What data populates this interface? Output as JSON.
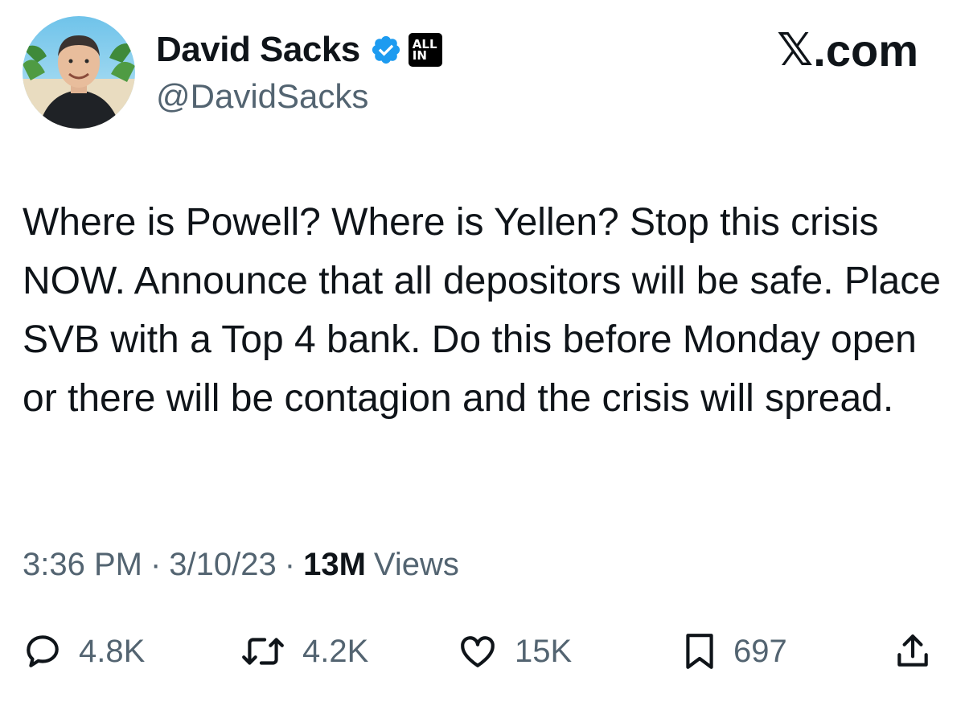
{
  "author": {
    "display_name": "David Sacks",
    "handle": "@DavidSacks",
    "verified": true,
    "affiliate_badge_line1": "ALL",
    "affiliate_badge_line2": "IN"
  },
  "brand": {
    "x_glyph": "𝕏",
    "suffix": ".com"
  },
  "tweet": {
    "text": "Where is Powell? Where is Yellen? Stop this crisis NOW. Announce that all depositors will be safe. Place SVB with a Top 4 bank. Do this before Monday open or there will be contagion and the crisis will spread.",
    "time": "3:36 PM",
    "date": "3/10/23",
    "views_count": "13M",
    "views_label": "Views"
  },
  "actions": {
    "replies": "4.8K",
    "reposts": "4.2K",
    "likes": "15K",
    "bookmarks": "697"
  },
  "colors": {
    "text_primary": "#0f1419",
    "text_secondary": "#536471",
    "verified_blue": "#1d9bf0"
  },
  "icons": {
    "reply": "speech-bubble-icon",
    "repost": "repost-arrows-icon",
    "like": "heart-icon",
    "bookmark": "bookmark-icon",
    "share": "share-upload-icon",
    "verified": "verified-badge-icon"
  }
}
